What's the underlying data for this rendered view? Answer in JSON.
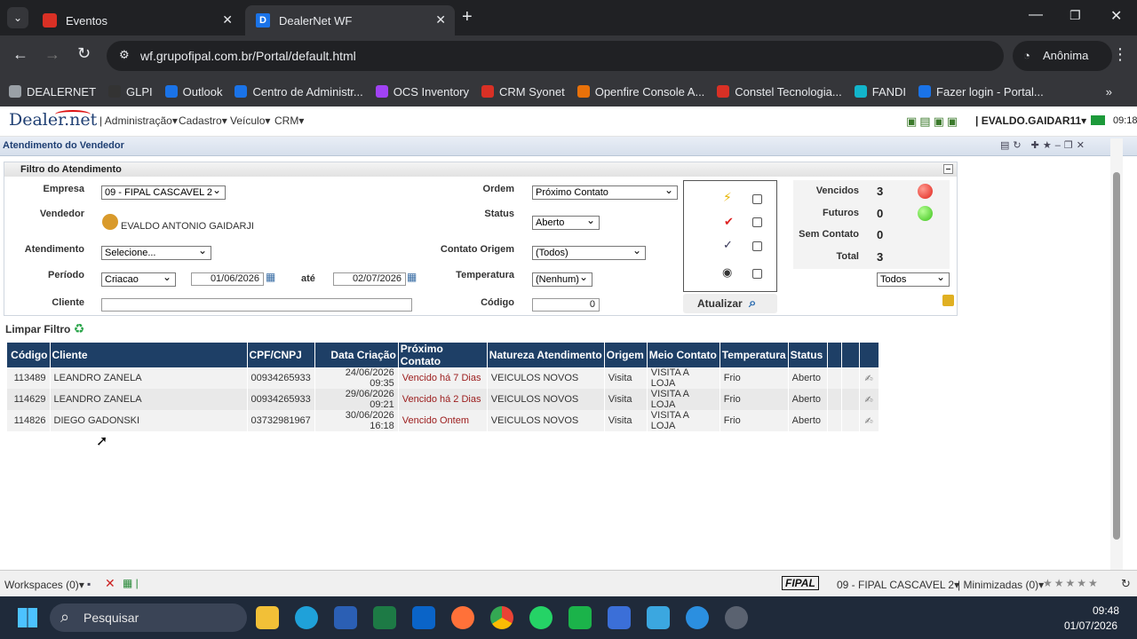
{
  "browser": {
    "tabs": [
      {
        "title": "Eventos",
        "active": false
      },
      {
        "title": "DealerNet WF",
        "active": true
      }
    ],
    "url": "wf.grupofipal.com.br/Portal/default.html",
    "profile": "Anônima",
    "bookmarks": [
      {
        "label": "DEALERNET",
        "color": "#9aa0a6"
      },
      {
        "label": "GLPI",
        "color": "#333"
      },
      {
        "label": "Outlook",
        "color": "#1a73e8"
      },
      {
        "label": "Centro de Administr...",
        "color": "#1a73e8"
      },
      {
        "label": "OCS Inventory",
        "color": "#a142f4"
      },
      {
        "label": "CRM Syonet",
        "color": "#d93025"
      },
      {
        "label": "Openfire Console A...",
        "color": "#e8710a"
      },
      {
        "label": "Constel Tecnologia...",
        "color": "#d93025"
      },
      {
        "label": "FANDI",
        "color": "#12b5cb"
      },
      {
        "label": "Fazer login - Portal...",
        "color": "#1a73e8"
      }
    ]
  },
  "app": {
    "logo": "Dealer.net",
    "menu": [
      "Administração",
      "Cadastro",
      "Veículo",
      "CRM"
    ],
    "user": "EVALDO.GAIDAR11",
    "clock": "09:18",
    "page_title": "Atendimento do Vendedor",
    "filter": {
      "title": "Filtro do Atendimento",
      "empresa_label": "Empresa",
      "empresa_value": "09 - FIPAL CASCAVEL 2",
      "vendedor_label": "Vendedor",
      "vendedor_value": "EVALDO ANTONIO GAIDARJI",
      "atendimento_label": "Atendimento",
      "atendimento_value": "Selecione...",
      "periodo_label": "Período",
      "periodo_value": "Criacao",
      "date_from": "01/06/2026",
      "ate_label": "até",
      "date_to": "02/07/2026",
      "cliente_label": "Cliente",
      "cliente_value": "",
      "ordem_label": "Ordem",
      "ordem_value": "Próximo Contato",
      "status_label": "Status",
      "status_value": "Aberto",
      "contato_label": "Contato Origem",
      "contato_value": "(Todos)",
      "temperatura_label": "Temperatura",
      "temperatura_value": "(Nenhum)",
      "codigo_label": "Código",
      "codigo_value": "0",
      "atualizar_label": "Atualizar",
      "counts": [
        {
          "label": "Vencidos",
          "value": "3",
          "color": "#e0241b"
        },
        {
          "label": "Futuros",
          "value": "0",
          "color": "#3cc21a"
        },
        {
          "label": "Sem Contato",
          "value": "0"
        },
        {
          "label": "Total",
          "value": "3"
        }
      ],
      "todos_value": "Todos"
    },
    "limpar_label": "Limpar Filtro",
    "table": {
      "headers": [
        "Código",
        "Cliente",
        "CPF/CNPJ",
        "Data Criação",
        "Próximo Contato",
        "Natureza Atendimento",
        "Origem",
        "Meio Contato",
        "Temperatura",
        "Status",
        "",
        "",
        ""
      ],
      "rows": [
        [
          "113489",
          "LEANDRO ZANELA",
          "00934265933",
          "24/06/2026 09:35",
          "Vencido há 7 Dias",
          "VEICULOS NOVOS",
          "Visita",
          "VISITA A LOJA",
          "Frio",
          "Aberto"
        ],
        [
          "114629",
          "LEANDRO ZANELA",
          "00934265933",
          "29/06/2026 09:21",
          "Vencido há 2 Dias",
          "VEICULOS NOVOS",
          "Visita",
          "VISITA A LOJA",
          "Frio",
          "Aberto"
        ],
        [
          "114826",
          "DIEGO GADONSKI",
          "03732981967",
          "30/06/2026 16:18",
          "Vencido Ontem",
          "VEICULOS NOVOS",
          "Visita",
          "VISITA A LOJA",
          "Frio",
          "Aberto"
        ]
      ]
    },
    "statusbar": {
      "workspaces": "Workspaces (0)",
      "brand": "FIPAL",
      "empresa": "09 - FIPAL CASCAVEL 2",
      "minimizadas": "Minimizadas (0)"
    }
  },
  "taskbar": {
    "search_placeholder": "Pesquisar",
    "time": "09:48",
    "date": "01/07/2026"
  }
}
